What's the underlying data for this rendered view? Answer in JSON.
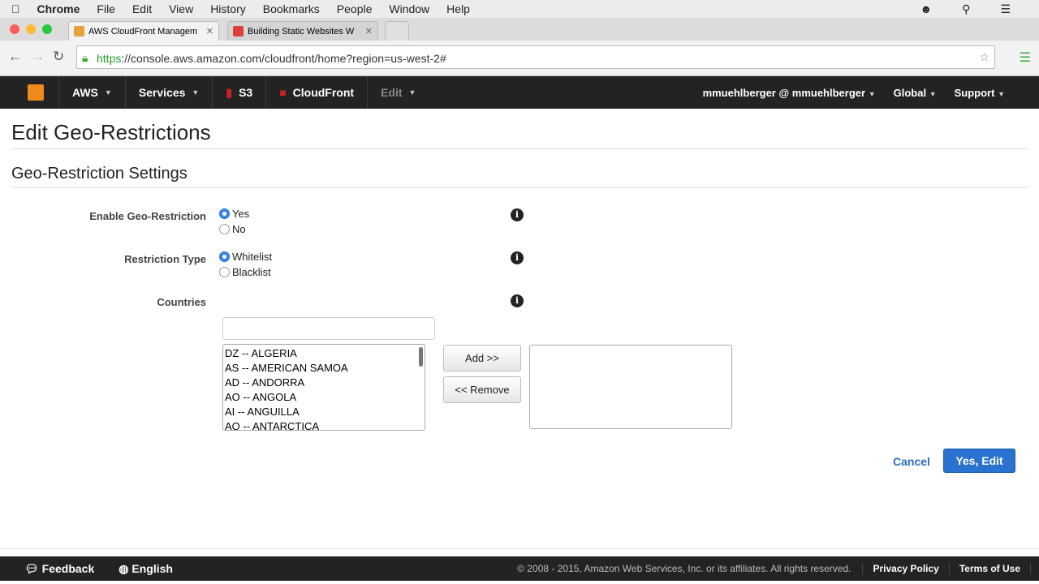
{
  "mac": {
    "app": "Chrome",
    "menus": [
      "File",
      "Edit",
      "View",
      "History",
      "Bookmarks",
      "People",
      "Window",
      "Help"
    ]
  },
  "browser": {
    "tabs": [
      {
        "title": "AWS CloudFront Managem"
      },
      {
        "title": "Building Static Websites W"
      }
    ],
    "url_scheme": "https",
    "url_rest": "://console.aws.amazon.com/cloudfront/home?region=us-west-2#"
  },
  "nav": {
    "aws": "AWS",
    "services": "Services",
    "s3": "S3",
    "cloudfront": "CloudFront",
    "edit": "Edit",
    "user": "mmuehlberger @ mmuehlberger",
    "region": "Global",
    "support": "Support"
  },
  "page": {
    "title": "Edit Geo-Restrictions",
    "section": "Geo-Restriction Settings",
    "enable_label": "Enable Geo-Restriction",
    "yes": "Yes",
    "no": "No",
    "type_label": "Restriction Type",
    "whitelist": "Whitelist",
    "blacklist": "Blacklist",
    "countries_label": "Countries",
    "filter_value": "",
    "countries": [
      "DZ -- ALGERIA",
      "AS -- AMERICAN SAMOA",
      "AD -- ANDORRA",
      "AO -- ANGOLA",
      "AI -- ANGUILLA",
      "AQ -- ANTARCTICA"
    ],
    "add": "Add >>",
    "remove": "<< Remove",
    "cancel": "Cancel",
    "confirm": "Yes, Edit"
  },
  "footer": {
    "feedback": "Feedback",
    "language": "English",
    "copyright": "© 2008 - 2015, Amazon Web Services, Inc. or its affiliates. All rights reserved.",
    "privacy": "Privacy Policy",
    "terms": "Terms of Use"
  }
}
